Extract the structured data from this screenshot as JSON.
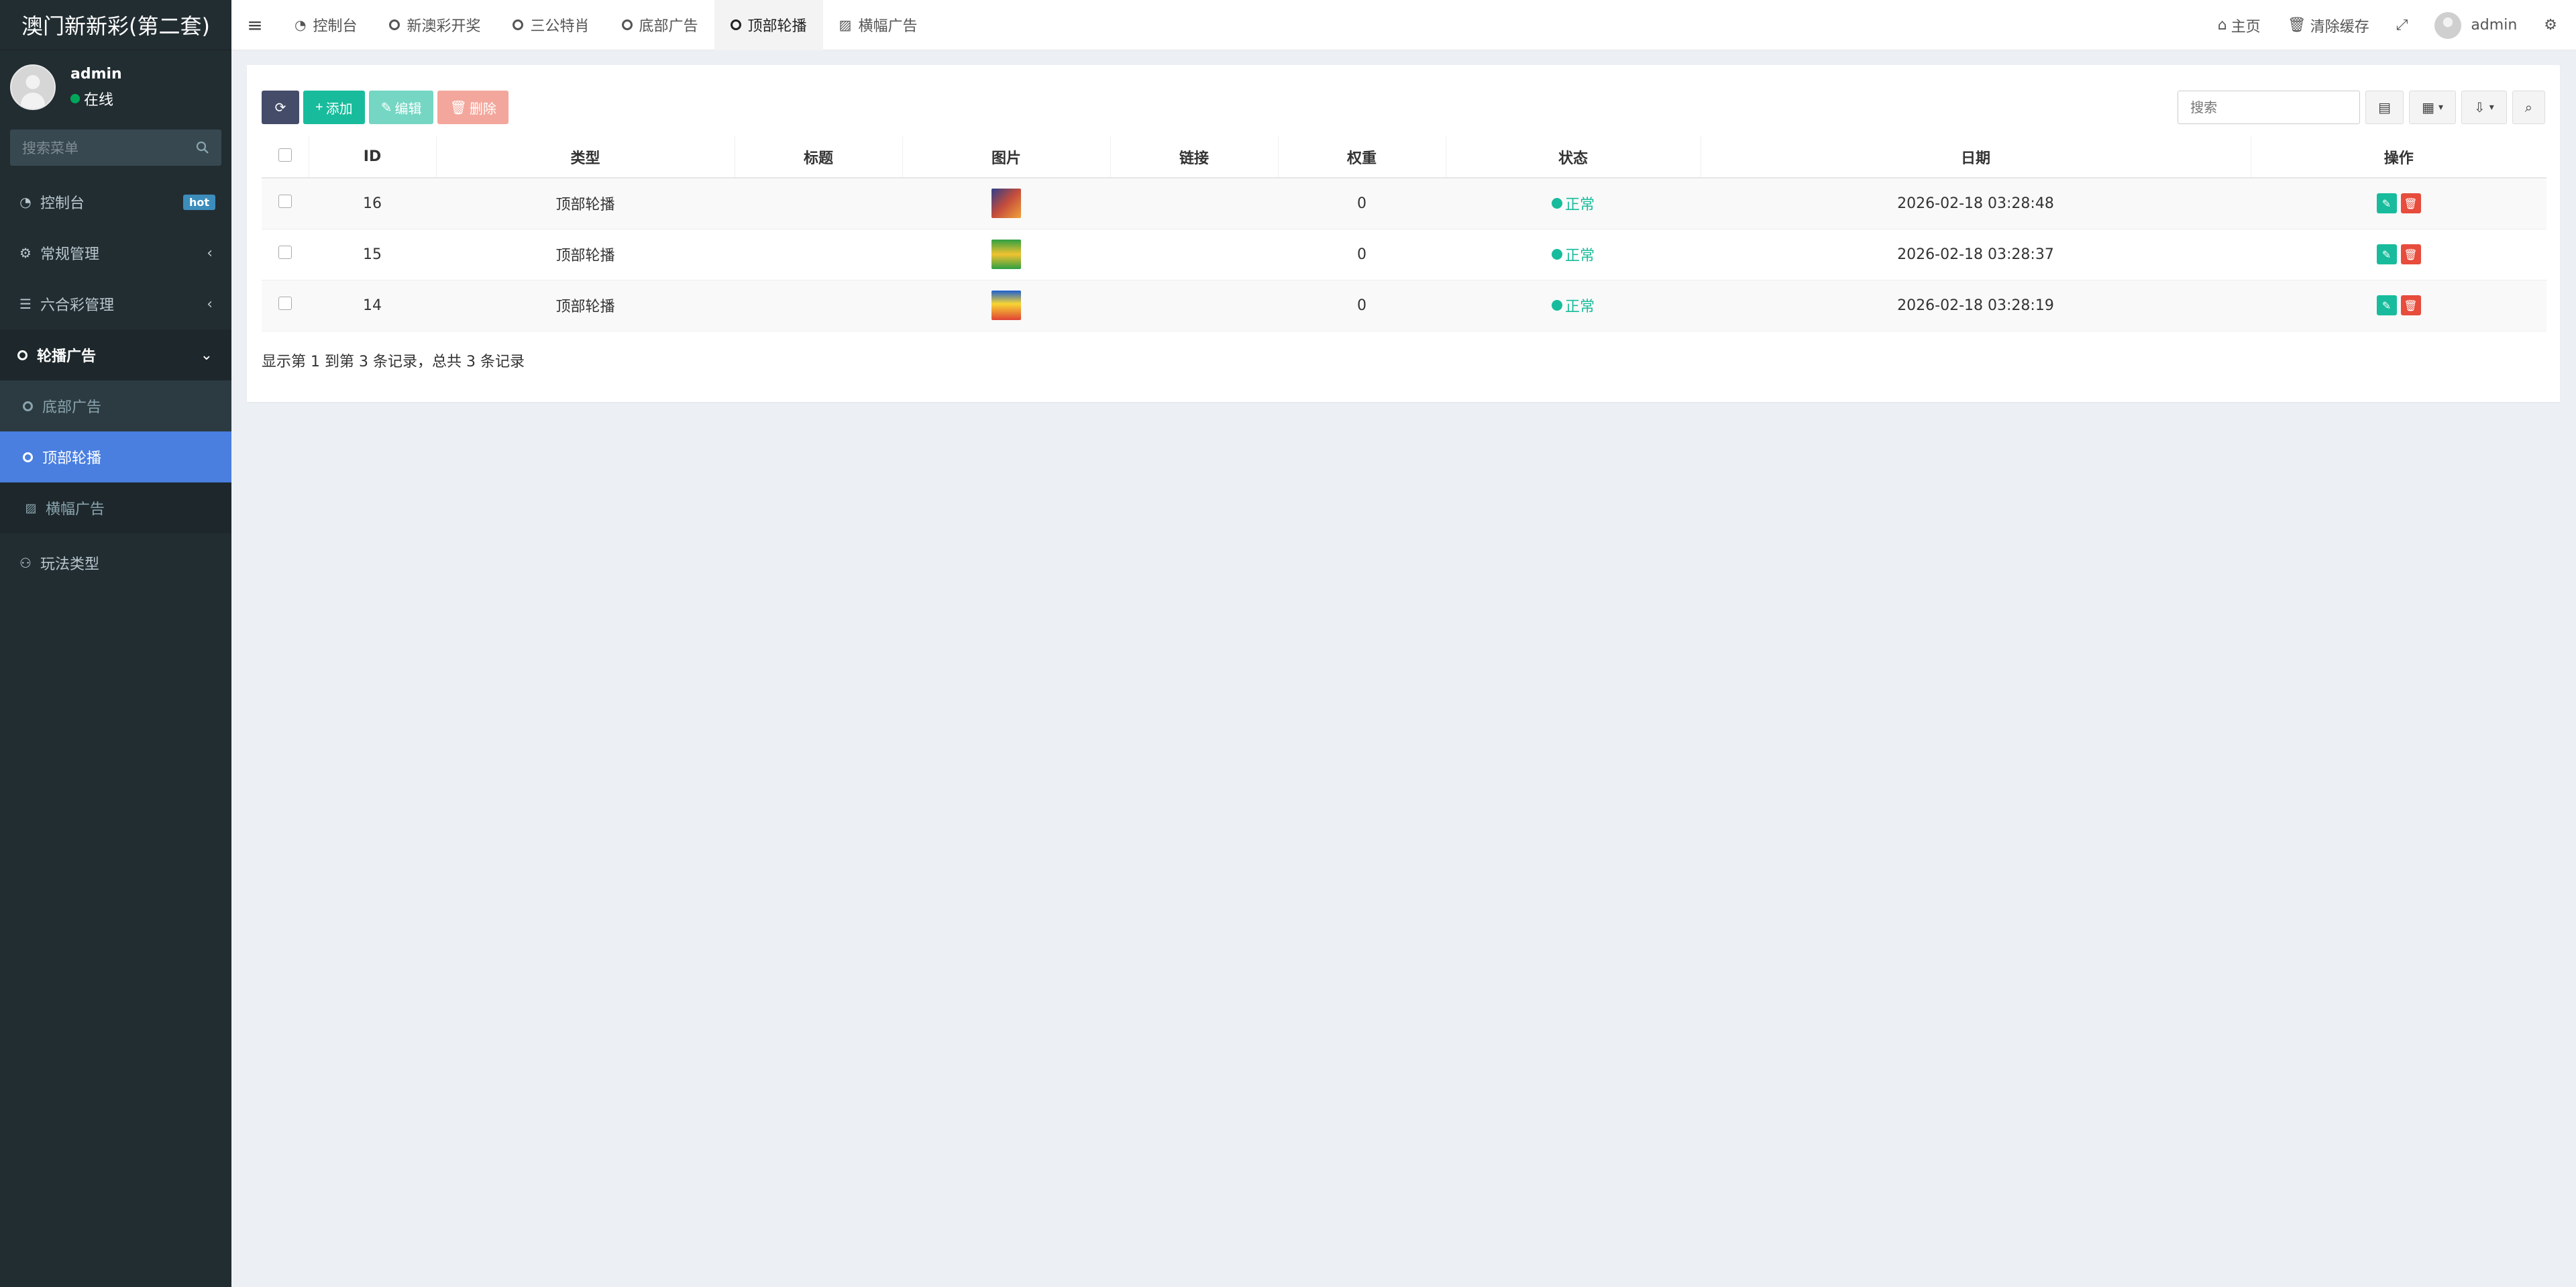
{
  "app": {
    "title": "澳门新新彩(第二套)"
  },
  "user": {
    "name": "admin",
    "status": "在线"
  },
  "sidebar": {
    "search_placeholder": "搜索菜单",
    "items": [
      {
        "label": "控制台",
        "icon": "dashboard-icon",
        "badge": "hot"
      },
      {
        "label": "常规管理",
        "icon": "cogs-icon"
      },
      {
        "label": "六合彩管理",
        "icon": "list-icon"
      },
      {
        "label": "轮播广告",
        "icon": "circle-icon",
        "open": true,
        "children": [
          {
            "label": "底部广告",
            "icon": "circle-icon"
          },
          {
            "label": "顶部轮播",
            "icon": "circle-icon",
            "active": true
          },
          {
            "label": "横幅广告",
            "icon": "image-icon"
          }
        ]
      },
      {
        "label": "玩法类型",
        "icon": "gamepad-icon"
      }
    ]
  },
  "topnav": {
    "tabs": [
      {
        "label": "控制台",
        "icon": "dashboard-icon"
      },
      {
        "label": "新澳彩开奖",
        "icon": "circle-icon"
      },
      {
        "label": "三公特肖",
        "icon": "circle-icon"
      },
      {
        "label": "底部广告",
        "icon": "circle-icon"
      },
      {
        "label": "顶部轮播",
        "icon": "circle-icon",
        "active": true
      },
      {
        "label": "横幅广告",
        "icon": "image-icon"
      }
    ],
    "home_label": "主页",
    "clear_cache_label": "清除缓存",
    "user_label": "admin"
  },
  "toolbar": {
    "add_label": "添加",
    "edit_label": "编辑",
    "delete_label": "删除",
    "search_placeholder": "搜索"
  },
  "table": {
    "columns": [
      "ID",
      "类型",
      "标题",
      "图片",
      "链接",
      "权重",
      "状态",
      "日期",
      "操作"
    ],
    "rows": [
      {
        "id": "16",
        "type": "顶部轮播",
        "title": "",
        "link": "",
        "weight": "0",
        "status": "正常",
        "date": "2026-02-18 03:28:48"
      },
      {
        "id": "15",
        "type": "顶部轮播",
        "title": "",
        "link": "",
        "weight": "0",
        "status": "正常",
        "date": "2026-02-18 03:28:37"
      },
      {
        "id": "14",
        "type": "顶部轮播",
        "title": "",
        "link": "",
        "weight": "0",
        "status": "正常",
        "date": "2026-02-18 03:28:19"
      }
    ],
    "summary": "显示第 1 到第 3 条记录，总共 3 条记录"
  },
  "colors": {
    "sidebar_bg": "#222d32",
    "active_menu": "#4a7fe0",
    "success": "#18bc9c",
    "danger": "#e74c3c"
  }
}
